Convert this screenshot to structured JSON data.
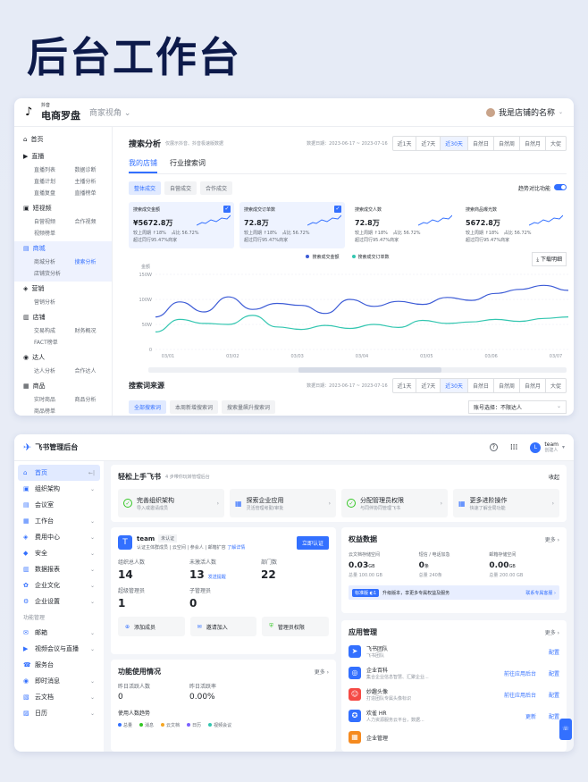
{
  "hero_title": "后台工作台",
  "s1": {
    "brand_small": "抖音",
    "brand": "电商罗盘",
    "view_select": "商家视角",
    "user": "我是店铺的名称",
    "sidebar": [
      {
        "title": "首页",
        "rows": []
      },
      {
        "title": "直播",
        "rows": [
          [
            "直播列表",
            "数据诊断"
          ],
          [
            "直播计划",
            "主播分析"
          ],
          [
            "直播复盘",
            "直播榜单"
          ]
        ]
      },
      {
        "title": "短视频",
        "rows": [
          [
            "自营视频",
            "合作视频"
          ],
          [
            "视频榜单",
            ""
          ]
        ]
      },
      {
        "title": "商城",
        "rows": [
          [
            "商城分析",
            "搜索分析"
          ],
          [
            "店铺货分析",
            ""
          ]
        ]
      },
      {
        "title": "营销",
        "rows": [
          [
            "营销分析",
            ""
          ]
        ]
      },
      {
        "title": "店铺",
        "rows": [
          [
            "交易构成",
            "财务概况"
          ],
          [
            "FACT榜单",
            ""
          ]
        ]
      },
      {
        "title": "达人",
        "rows": [
          [
            "达人分析",
            "合作达人"
          ]
        ]
      },
      {
        "title": "商品",
        "rows": [
          [
            "实时商品",
            "商品分析"
          ],
          [
            "商品榜单",
            ""
          ]
        ]
      }
    ],
    "page_title": "搜索分析",
    "page_sub": "仅展示抖音、抖音极速版数据",
    "date_range": "数据日期：2023-06-17 ~ 2023-07-16",
    "ranges": [
      "近1天",
      "近7天",
      "近30天",
      "自然日",
      "自然周",
      "自然月",
      "大促"
    ],
    "tabs": [
      "我的店铺",
      "行业搜索词"
    ],
    "chips": [
      "整体成交",
      "自营成交",
      "合作成交"
    ],
    "compare_label": "趋势对比功能",
    "metrics": [
      {
        "label": "搜索成交金额",
        "value": "¥5672.8万",
        "l1": "较上周期 ↑18%",
        "l2": "占比 56.72%",
        "l3": "超过同行95.47%商家",
        "selected": true
      },
      {
        "label": "搜索成交订单数",
        "value": "72.8万",
        "l1": "较上周期 ↑18%",
        "l2": "占比 56.72%",
        "l3": "超过同行95.47%商家",
        "selected": true
      },
      {
        "label": "搜索成交人数",
        "value": "72.8万",
        "l1": "较上周期 ↑18%",
        "l2": "占比 56.72%",
        "l3": "超过同行95.47%商家",
        "selected": false
      },
      {
        "label": "搜索商品曝光数",
        "value": "5672.8万",
        "l1": "较上周期 ↑18%",
        "l2": "占比 56.72%",
        "l3": "超过同行95.47%商家",
        "selected": false
      }
    ],
    "legend": [
      "搜索成交金额",
      "搜索成交订单数"
    ],
    "download": "下载明细",
    "chart_data": {
      "type": "line",
      "ylabel": "金额",
      "yticks": [
        "150W",
        "100W",
        "50W",
        "0"
      ],
      "ylim": [
        0,
        150
      ],
      "x": [
        "03/01",
        "03/02",
        "03/03",
        "03/04",
        "03/05",
        "03/06",
        "03/07"
      ],
      "series": [
        {
          "name": "搜索成交金额",
          "color": "#3c5bd6",
          "values": [
            65,
            95,
            75,
            105,
            80,
            92,
            88,
            72,
            100,
            86,
            96,
            90,
            104,
            98,
            112,
            120,
            128,
            118
          ]
        },
        {
          "name": "搜索成交订单数",
          "color": "#33c6b0",
          "values": [
            35,
            60,
            52,
            50,
            68,
            45,
            40,
            48,
            42,
            50,
            44,
            58,
            52,
            55,
            60,
            56,
            62,
            65
          ]
        }
      ]
    },
    "source_title": "搜索词来源",
    "source_chips": [
      "全部搜索词",
      "本周新增搜索词",
      "搜索量飙升搜索词"
    ],
    "account_select": "账号选择：不限达人"
  },
  "s2": {
    "brand": "飞书管理后台",
    "user": "team",
    "user_sub": "创建人",
    "avatar_letter": "L",
    "sidebar": [
      {
        "label": "首页",
        "icon": "⌂",
        "chev": "←|",
        "on": true
      },
      {
        "label": "组织架构",
        "icon": "▣",
        "chev": "⌄"
      },
      {
        "label": "会议室",
        "icon": "▤",
        "chev": ""
      },
      {
        "label": "工作台",
        "icon": "▦",
        "chev": "⌄"
      },
      {
        "label": "费用中心",
        "icon": "◈",
        "chev": "⌄"
      },
      {
        "label": "安全",
        "icon": "◆",
        "chev": "⌄"
      },
      {
        "label": "数据报表",
        "icon": "▥",
        "chev": "⌄"
      },
      {
        "label": "企业文化",
        "icon": "✿",
        "chev": "⌄"
      },
      {
        "label": "企业设置",
        "icon": "⚙",
        "chev": "⌄"
      }
    ],
    "sidebar_label": "功能管理",
    "sidebar2": [
      {
        "label": "邮箱",
        "icon": "✉",
        "chev": "⌄"
      },
      {
        "label": "视频会议与直播",
        "icon": "▶",
        "chev": "⌄"
      },
      {
        "label": "服务台",
        "icon": "☎",
        "chev": ""
      },
      {
        "label": "即时消息",
        "icon": "◉",
        "chev": "⌄"
      },
      {
        "label": "云文档",
        "icon": "▧",
        "chev": "⌄"
      },
      {
        "label": "日历",
        "icon": "▨",
        "chev": "⌄"
      }
    ],
    "onboard_title": "轻松上手飞书",
    "onboard_sub": "4 步带你玩转管理后台",
    "collapse": "收起",
    "steps": [
      {
        "t": "完善组织架构",
        "s": "导入或邀请成员",
        "done": true
      },
      {
        "t": "探索企业应用",
        "s": "灵活管理考勤/审批",
        "done": false
      },
      {
        "t": "分配管理员权限",
        "s": "与同伴协同管理飞书",
        "done": true
      },
      {
        "t": "更多进阶操作",
        "s": "快速了解全局功能",
        "done": false
      }
    ],
    "org": {
      "name": "team",
      "tag": "未认证",
      "desc": "认证主体群成员 | 云空间 | 参会人 | 邮箱扩容",
      "desc_link": "了解详情",
      "verify": "立即认证",
      "stats": [
        {
          "label": "组织总人数",
          "value": "14"
        },
        {
          "label": "未激活人数",
          "value": "13",
          "link": "发送提醒"
        },
        {
          "label": "部门数",
          "value": "22"
        },
        {
          "label": "超级管理员",
          "value": "1"
        },
        {
          "label": "子管理员",
          "value": "0"
        }
      ],
      "actions": [
        "添加成员",
        "邀请加入",
        "管理员权限"
      ]
    },
    "rights": {
      "title": "权益数据",
      "more": "更多 ›",
      "items": [
        {
          "label": "云文档存储空间",
          "value": "0.03",
          "unit": "GB",
          "sub": "总量 100.00 GB"
        },
        {
          "label": "短信 / 电话加急",
          "value": "0",
          "unit": "条",
          "sub": "总量 240条"
        },
        {
          "label": "邮箱存储空间",
          "value": "0.00",
          "unit": "GB",
          "sub": "总量 200.00 GB"
        }
      ],
      "banner_tag": "标准版 ◐1",
      "banner": "升级版本，享更多专属权益及服务",
      "banner_link": "联系专属客服 ›"
    },
    "usage": {
      "title": "功能使用情况",
      "more": "更多 ›",
      "s1_label": "昨日活跃人数",
      "s1_value": "0",
      "s2_label": "昨日活跃率",
      "s2_value": "0.00%",
      "trend": "使用人数趋势",
      "legend": [
        "总量",
        "消息",
        "云文档",
        "日历",
        "视频会议"
      ]
    },
    "apps": {
      "title": "应用管理",
      "more": "更多 ›",
      "items": [
        {
          "name": "飞书团队",
          "sub": "飞书团队",
          "act1": "",
          "act2": "配置",
          "color": "#3370ff",
          "icon": "➤"
        },
        {
          "name": "企业百科",
          "sub": "集合企业信息智慧、汇聚企业...",
          "act1": "前往应用后台",
          "act2": "配置",
          "color": "#3370ff",
          "icon": "◎"
        },
        {
          "name": "妙趣头像",
          "sub": "打造团队专属头像标识",
          "act1": "前往应用后台",
          "act2": "配置",
          "color": "#f54a45",
          "icon": "☺"
        },
        {
          "name": "欢雀 HR",
          "sub": "人力资源服务云平台，数据...",
          "act1": "更新",
          "act2": "配置",
          "color": "#3370ff",
          "icon": "✪"
        },
        {
          "name": "企业管理",
          "sub": "",
          "act1": "",
          "act2": "",
          "color": "#f58a1f",
          "icon": "▦"
        }
      ]
    }
  }
}
